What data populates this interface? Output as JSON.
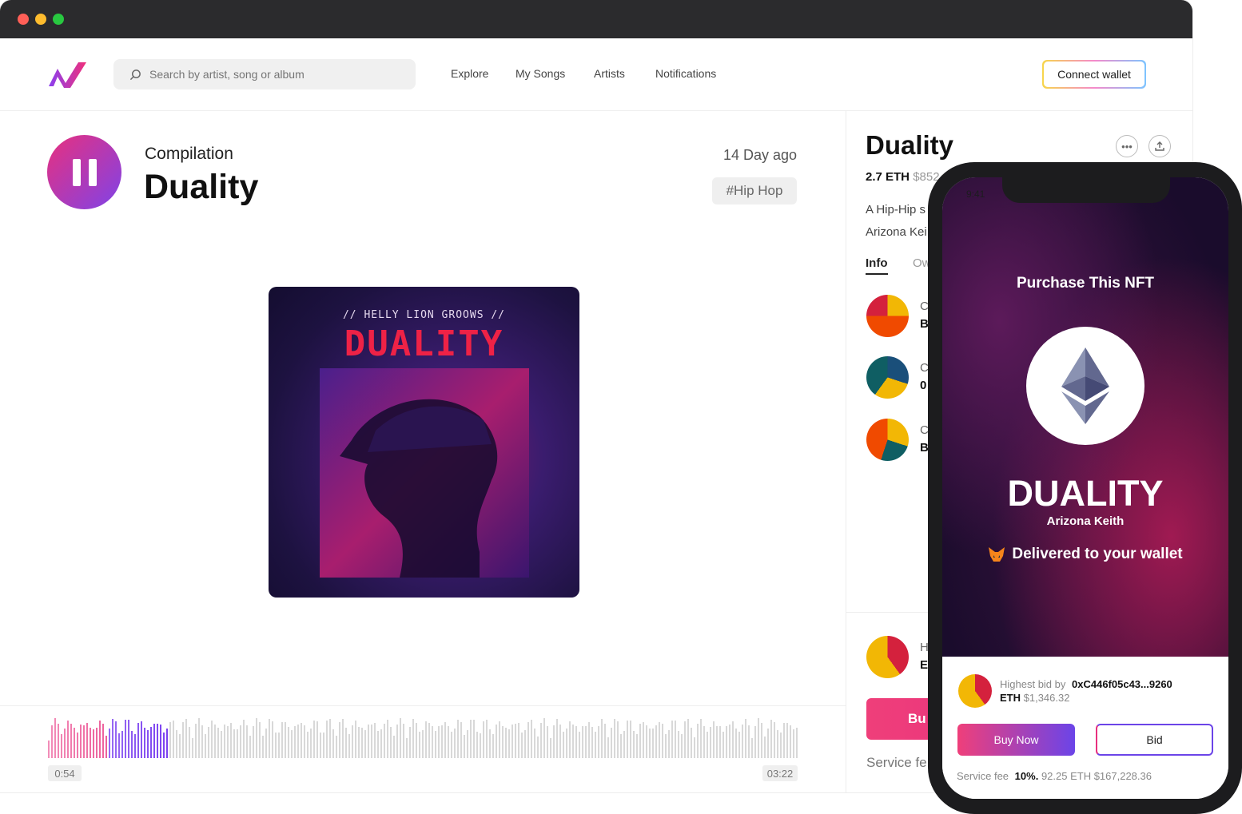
{
  "nav": {
    "search_placeholder": "Search by artist, song or album",
    "items": [
      "Explore",
      "My Songs",
      "Artists",
      "Notifications"
    ],
    "connect_label": "Connect wallet"
  },
  "track": {
    "type": "Compilation",
    "title": "Duality",
    "posted": "14 Day ago",
    "genre_tag": "#Hip Hop",
    "cover_artist": "// HELLY LION GROOWS //",
    "cover_title": "DUALITY",
    "elapsed": "0:54",
    "duration": "03:22",
    "played_fraction": 0.16
  },
  "details": {
    "title": "Duality",
    "price_eth": "2.7 ETH",
    "price_usd": "$852",
    "desc_line1": "A Hip-Hip s",
    "desc_line2": "Arizona Kei",
    "tabs": [
      "Info",
      "Ow"
    ],
    "people": [
      {
        "line1": "C",
        "line2": "B"
      },
      {
        "line1": "C",
        "line2": "0"
      },
      {
        "line1": "C",
        "line2": "B"
      }
    ],
    "bid_line1": "H",
    "bid_line2": "E",
    "buy_label": "Bu",
    "service_label": "Service fe"
  },
  "phone": {
    "status_time": "9:41",
    "heading": "Purchase This NFT",
    "nft_title": "DUALITY",
    "nft_artist": "Arizona Keith",
    "delivered": "Delivered to your wallet",
    "highest_bid_label": "Highest bid by",
    "bidder": "0xC446f05c43...9260",
    "bid_eth": "ETH",
    "bid_usd": "$1,346.32",
    "buy_now": "Buy Now",
    "bid_button": "Bid",
    "service_fee_label": "Service fee",
    "service_fee_pct": "10%.",
    "service_fee_detail": "92.25 ETH $167,228.36"
  },
  "colors": {
    "accent_pink": "#e8307e",
    "accent_purple": "#6b44e8",
    "wave_played": "#7a3ff0",
    "wave_unplayed": "#d8d8d8"
  }
}
